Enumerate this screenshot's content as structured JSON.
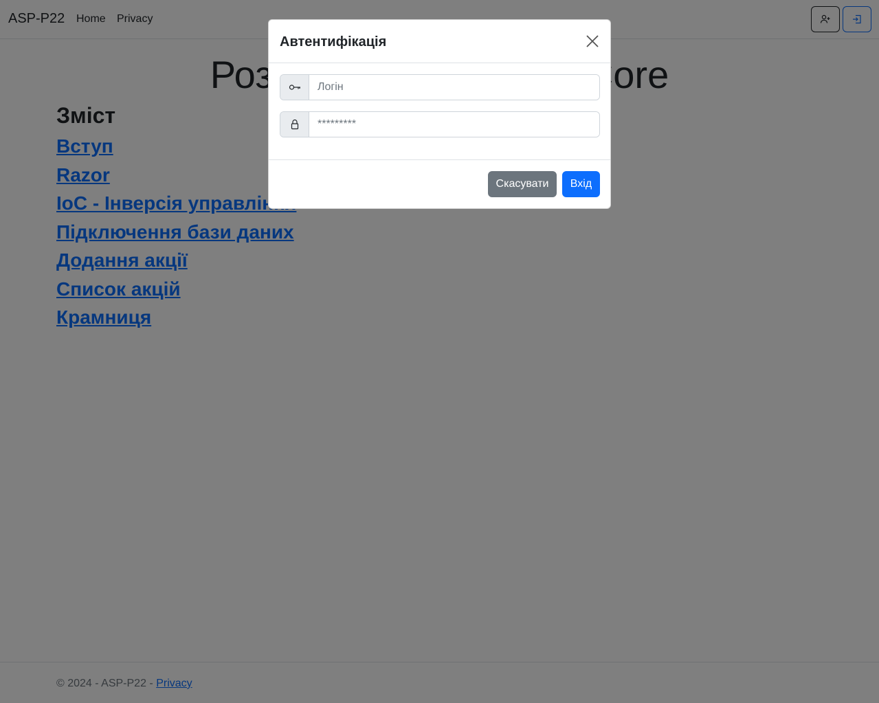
{
  "navbar": {
    "brand": "ASP-P22",
    "links": [
      "Home",
      "Privacy"
    ],
    "signup_icon": "person-plus-icon",
    "signin_icon": "box-arrow-in-right-icon"
  },
  "main": {
    "title": "Розробка з ASP.NET Core",
    "toc_heading": "Зміст",
    "toc_links": [
      "Вступ",
      "Razor",
      "IoC - Інверсія управління",
      "Підключення бази даних",
      "Додання акції",
      "Список акцій",
      "Крамниця"
    ]
  },
  "footer": {
    "copyright": "© 2024 - ASP-P22 - ",
    "privacy": "Privacy"
  },
  "modal": {
    "title": "Автентифікація",
    "close_icon": "close-icon",
    "login": {
      "icon": "key-icon",
      "placeholder": "Логін",
      "value": ""
    },
    "password": {
      "icon": "lock-icon",
      "placeholder": "*********",
      "value": ""
    },
    "cancel_label": "Скасувати",
    "submit_label": "Вхід"
  },
  "colors": {
    "primary": "#0d6efd",
    "secondary": "#6c757d",
    "backdrop": "rgba(0,0,0,0.5)"
  }
}
